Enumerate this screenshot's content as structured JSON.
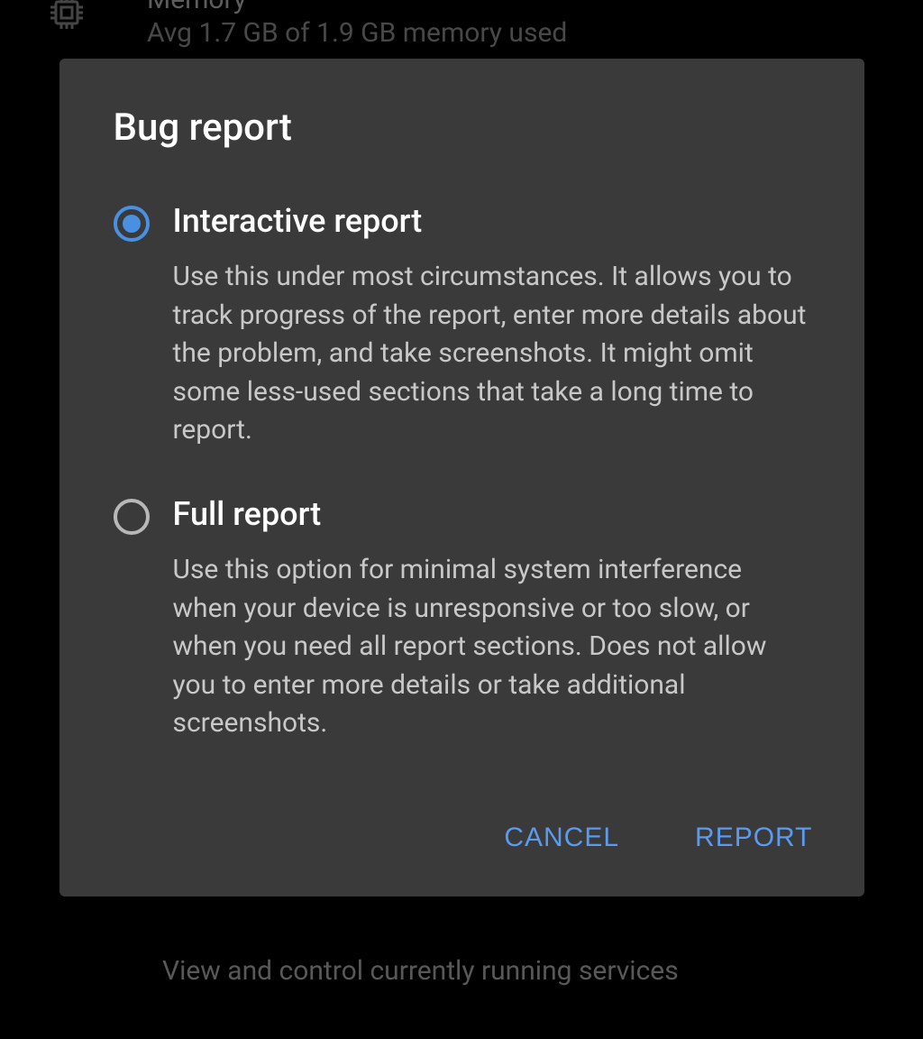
{
  "background": {
    "memory_title": "Memory",
    "memory_subtitle": "Avg 1.7 GB of 1.9 GB memory used",
    "bottom_text": "View and control currently running services"
  },
  "dialog": {
    "title": "Bug report",
    "options": [
      {
        "title": "Interactive report",
        "description": "Use this under most circumstances. It allows you to track progress of the report, enter more details about the problem, and take screenshots. It might omit some less-used sections that take a long time to report.",
        "selected": true
      },
      {
        "title": "Full report",
        "description": "Use this option for minimal system interference when your device is unresponsive or too slow, or when you need all report sections. Does not allow you to enter more details or take additional screenshots.",
        "selected": false
      }
    ],
    "buttons": {
      "cancel": "CANCEL",
      "report": "REPORT"
    }
  },
  "colors": {
    "accent": "#4a90e2",
    "dialog_bg": "#3a3a3a",
    "text_primary": "#ffffff",
    "text_secondary": "#c8c8c8"
  }
}
